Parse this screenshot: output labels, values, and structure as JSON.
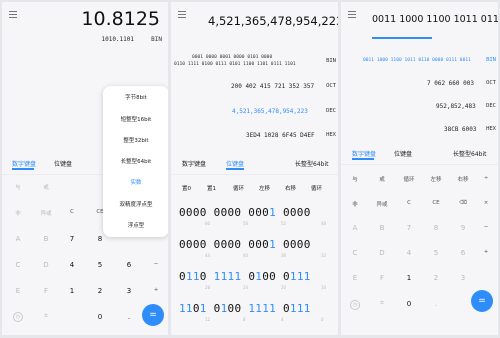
{
  "panel1": {
    "display_value": "10.8125",
    "bin_value": "1010.1101",
    "bin_label": "BIN",
    "tabs": [
      "数字键盘",
      "位键盘"
    ],
    "popup_options": [
      "字节8bit",
      "短整型16bit",
      "整型32bit",
      "长整型64bit",
      "实数",
      "双精度浮点型",
      "浮点型"
    ],
    "popup_selected": "实数",
    "keys": [
      [
        "与",
        "或",
        "",
        "",
        ""
      ],
      [
        "非",
        "异或",
        "C",
        "CE",
        ""
      ],
      [
        "A",
        "B",
        "7",
        "8",
        "9"
      ],
      [
        "C",
        "D",
        "4",
        "5",
        "6"
      ],
      [
        "E",
        "F",
        "1",
        "2",
        "3"
      ],
      [
        "",
        "±",
        "0",
        ".",
        "="
      ]
    ]
  },
  "panel2": {
    "display_value": "4,521,365,478,954,223",
    "bin_lines": [
      "0001 0000 0001 0000 0101 0000",
      "0110 1111 0100 0111 0101 1100 1101 0111 1101"
    ],
    "bin_label": "BIN",
    "oct_value": "200 402 415 721 352 357",
    "oct_label": "OCT",
    "dec_value": "4,521,365,478,954,223",
    "dec_label": "DEC",
    "hex_value": "3ED4 1028 6F45 D4EF",
    "hex_label": "HEX",
    "tabs": [
      "数字键盘",
      "位键盘",
      "长整型64bit"
    ],
    "bit_ops": [
      "置0",
      "置1",
      "循环",
      "左移",
      "右移",
      "循环"
    ],
    "bit_rows": [
      {
        "bits": "0000 0000 0001 0000",
        "sub": [
          "60",
          "56",
          "52",
          "48"
        ]
      },
      {
        "bits": "0000 0000 0001 0000",
        "sub": [
          "44",
          "40",
          "36",
          "32"
        ]
      },
      {
        "bits": "0110 1111 0100 0111",
        "sub": [
          "28",
          "24",
          "20",
          "16"
        ]
      },
      {
        "bits": "1101 0100 1111 0111",
        "sub": [
          "12",
          "8",
          "4",
          "0"
        ]
      }
    ]
  },
  "panel3": {
    "display_top": "0011 1000 1100 1011 0110 00",
    "bin_line": "0011 1000 1100 1011 0110 0000 0111 0011",
    "bin_label": "BIN",
    "oct_value": "7 062 660 003",
    "oct_label": "OCT",
    "dec_value": "952,852,483",
    "dec_label": "DEC",
    "hex_value": "38CB 6003",
    "hex_label": "HEX",
    "tabs": [
      "数字键盘",
      "位键盘",
      "长整型64bit"
    ],
    "keys": [
      [
        "与",
        "或",
        "循环",
        "左移",
        "右移"
      ],
      [
        "非",
        "异或",
        "C",
        "CE",
        "⌫"
      ],
      [
        "A",
        "B",
        "7",
        "8",
        "9"
      ],
      [
        "C",
        "D",
        "4",
        "5",
        "6"
      ],
      [
        "E",
        "F",
        "1",
        "2",
        "3"
      ],
      [
        "",
        "±",
        "0",
        ".",
        "="
      ]
    ]
  }
}
